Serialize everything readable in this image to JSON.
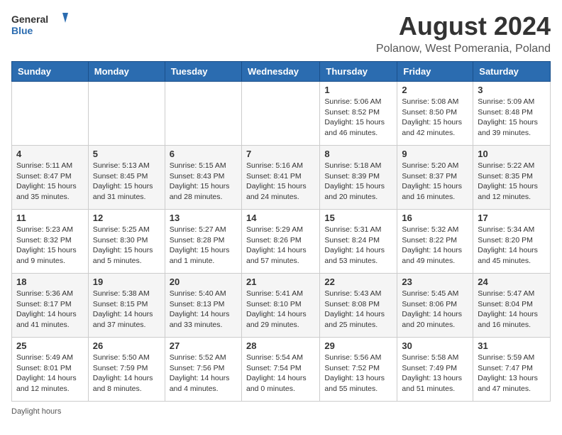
{
  "header": {
    "logo_general": "General",
    "logo_blue": "Blue",
    "title": "August 2024",
    "subtitle": "Polanow, West Pomerania, Poland"
  },
  "days_of_week": [
    "Sunday",
    "Monday",
    "Tuesday",
    "Wednesday",
    "Thursday",
    "Friday",
    "Saturday"
  ],
  "weeks": [
    [
      {
        "day": "",
        "info": ""
      },
      {
        "day": "",
        "info": ""
      },
      {
        "day": "",
        "info": ""
      },
      {
        "day": "",
        "info": ""
      },
      {
        "day": "1",
        "info": "Sunrise: 5:06 AM\nSunset: 8:52 PM\nDaylight: 15 hours\nand 46 minutes."
      },
      {
        "day": "2",
        "info": "Sunrise: 5:08 AM\nSunset: 8:50 PM\nDaylight: 15 hours\nand 42 minutes."
      },
      {
        "day": "3",
        "info": "Sunrise: 5:09 AM\nSunset: 8:48 PM\nDaylight: 15 hours\nand 39 minutes."
      }
    ],
    [
      {
        "day": "4",
        "info": "Sunrise: 5:11 AM\nSunset: 8:47 PM\nDaylight: 15 hours\nand 35 minutes."
      },
      {
        "day": "5",
        "info": "Sunrise: 5:13 AM\nSunset: 8:45 PM\nDaylight: 15 hours\nand 31 minutes."
      },
      {
        "day": "6",
        "info": "Sunrise: 5:15 AM\nSunset: 8:43 PM\nDaylight: 15 hours\nand 28 minutes."
      },
      {
        "day": "7",
        "info": "Sunrise: 5:16 AM\nSunset: 8:41 PM\nDaylight: 15 hours\nand 24 minutes."
      },
      {
        "day": "8",
        "info": "Sunrise: 5:18 AM\nSunset: 8:39 PM\nDaylight: 15 hours\nand 20 minutes."
      },
      {
        "day": "9",
        "info": "Sunrise: 5:20 AM\nSunset: 8:37 PM\nDaylight: 15 hours\nand 16 minutes."
      },
      {
        "day": "10",
        "info": "Sunrise: 5:22 AM\nSunset: 8:35 PM\nDaylight: 15 hours\nand 12 minutes."
      }
    ],
    [
      {
        "day": "11",
        "info": "Sunrise: 5:23 AM\nSunset: 8:32 PM\nDaylight: 15 hours\nand 9 minutes."
      },
      {
        "day": "12",
        "info": "Sunrise: 5:25 AM\nSunset: 8:30 PM\nDaylight: 15 hours\nand 5 minutes."
      },
      {
        "day": "13",
        "info": "Sunrise: 5:27 AM\nSunset: 8:28 PM\nDaylight: 15 hours\nand 1 minute."
      },
      {
        "day": "14",
        "info": "Sunrise: 5:29 AM\nSunset: 8:26 PM\nDaylight: 14 hours\nand 57 minutes."
      },
      {
        "day": "15",
        "info": "Sunrise: 5:31 AM\nSunset: 8:24 PM\nDaylight: 14 hours\nand 53 minutes."
      },
      {
        "day": "16",
        "info": "Sunrise: 5:32 AM\nSunset: 8:22 PM\nDaylight: 14 hours\nand 49 minutes."
      },
      {
        "day": "17",
        "info": "Sunrise: 5:34 AM\nSunset: 8:20 PM\nDaylight: 14 hours\nand 45 minutes."
      }
    ],
    [
      {
        "day": "18",
        "info": "Sunrise: 5:36 AM\nSunset: 8:17 PM\nDaylight: 14 hours\nand 41 minutes."
      },
      {
        "day": "19",
        "info": "Sunrise: 5:38 AM\nSunset: 8:15 PM\nDaylight: 14 hours\nand 37 minutes."
      },
      {
        "day": "20",
        "info": "Sunrise: 5:40 AM\nSunset: 8:13 PM\nDaylight: 14 hours\nand 33 minutes."
      },
      {
        "day": "21",
        "info": "Sunrise: 5:41 AM\nSunset: 8:10 PM\nDaylight: 14 hours\nand 29 minutes."
      },
      {
        "day": "22",
        "info": "Sunrise: 5:43 AM\nSunset: 8:08 PM\nDaylight: 14 hours\nand 25 minutes."
      },
      {
        "day": "23",
        "info": "Sunrise: 5:45 AM\nSunset: 8:06 PM\nDaylight: 14 hours\nand 20 minutes."
      },
      {
        "day": "24",
        "info": "Sunrise: 5:47 AM\nSunset: 8:04 PM\nDaylight: 14 hours\nand 16 minutes."
      }
    ],
    [
      {
        "day": "25",
        "info": "Sunrise: 5:49 AM\nSunset: 8:01 PM\nDaylight: 14 hours\nand 12 minutes."
      },
      {
        "day": "26",
        "info": "Sunrise: 5:50 AM\nSunset: 7:59 PM\nDaylight: 14 hours\nand 8 minutes."
      },
      {
        "day": "27",
        "info": "Sunrise: 5:52 AM\nSunset: 7:56 PM\nDaylight: 14 hours\nand 4 minutes."
      },
      {
        "day": "28",
        "info": "Sunrise: 5:54 AM\nSunset: 7:54 PM\nDaylight: 14 hours\nand 0 minutes."
      },
      {
        "day": "29",
        "info": "Sunrise: 5:56 AM\nSunset: 7:52 PM\nDaylight: 13 hours\nand 55 minutes."
      },
      {
        "day": "30",
        "info": "Sunrise: 5:58 AM\nSunset: 7:49 PM\nDaylight: 13 hours\nand 51 minutes."
      },
      {
        "day": "31",
        "info": "Sunrise: 5:59 AM\nSunset: 7:47 PM\nDaylight: 13 hours\nand 47 minutes."
      }
    ]
  ],
  "footer": {
    "daylight_label": "Daylight hours"
  }
}
